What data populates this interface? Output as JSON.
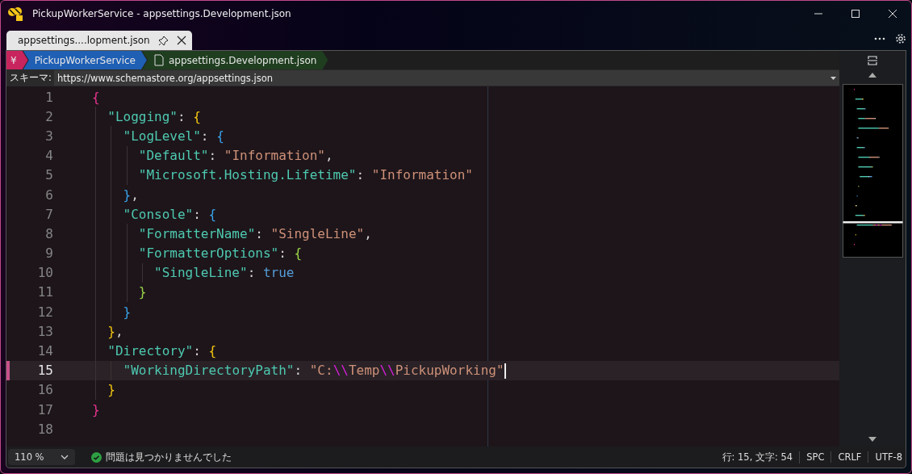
{
  "window": {
    "title": "PickupWorkerService - appsettings.Development.json"
  },
  "tabs": [
    {
      "label": "appsettings....lopment.json",
      "selected": true
    }
  ],
  "breadcrumb": [
    {
      "label": "¥",
      "kind": "root"
    },
    {
      "label": "PickupWorkerService",
      "kind": "project"
    },
    {
      "label": "appsettings.Development.json",
      "kind": "file"
    }
  ],
  "schema": {
    "label": "スキーマ:",
    "value": "https://www.schemastore.org/appsettings.json"
  },
  "editor": {
    "lines": [
      {
        "number": "1",
        "selected": false,
        "tokens": [
          {
            "kind": "open1",
            "text": "{"
          }
        ]
      },
      {
        "number": "2",
        "selected": false,
        "tokens": [
          {
            "kind": "key",
            "text": "\"Logging\""
          },
          {
            "kind": "punct",
            "text": ":"
          },
          {
            "kind": "open2",
            "text": "{"
          }
        ]
      },
      {
        "number": "3",
        "selected": false,
        "tokens": [
          {
            "kind": "key",
            "text": "\"LogLevel\""
          },
          {
            "kind": "punct",
            "text": ":"
          },
          {
            "kind": "open3",
            "text": "{"
          }
        ]
      },
      {
        "number": "4",
        "selected": false,
        "tokens": [
          {
            "kind": "key",
            "text": "\"Default\""
          },
          {
            "kind": "punct",
            "text": ":"
          },
          {
            "kind": "string",
            "text": "\"Information\""
          },
          {
            "kind": "punct",
            "text": ","
          }
        ]
      },
      {
        "number": "5",
        "selected": false,
        "tokens": [
          {
            "kind": "key",
            "text": "\"Microsoft.Hosting.Lifetime\""
          },
          {
            "kind": "punct",
            "text": ":"
          },
          {
            "kind": "string",
            "text": "\"Information\""
          }
        ]
      },
      {
        "number": "6",
        "selected": false,
        "tokens": [
          {
            "kind": "close3",
            "text": "}"
          },
          {
            "kind": "punct",
            "text": ","
          }
        ]
      },
      {
        "number": "7",
        "selected": false,
        "tokens": [
          {
            "kind": "key",
            "text": "\"Console\""
          },
          {
            "kind": "punct",
            "text": ":"
          },
          {
            "kind": "open3",
            "text": "{"
          }
        ]
      },
      {
        "number": "8",
        "selected": false,
        "tokens": [
          {
            "kind": "key",
            "text": "\"FormatterName\""
          },
          {
            "kind": "punct",
            "text": ":"
          },
          {
            "kind": "string",
            "text": "\"SingleLine\""
          },
          {
            "kind": "punct",
            "text": ","
          }
        ]
      },
      {
        "number": "9",
        "selected": false,
        "tokens": [
          {
            "kind": "key",
            "text": "\"FormatterOptions\""
          },
          {
            "kind": "punct",
            "text": ":"
          },
          {
            "kind": "open4",
            "text": "{"
          }
        ]
      },
      {
        "number": "10",
        "selected": false,
        "tokens": [
          {
            "kind": "key",
            "text": "\"SingleLine\""
          },
          {
            "kind": "punct",
            "text": ":"
          },
          {
            "kind": "keyword",
            "text": "true"
          }
        ]
      },
      {
        "number": "11",
        "selected": false,
        "tokens": [
          {
            "kind": "close4",
            "text": "}"
          }
        ]
      },
      {
        "number": "12",
        "selected": false,
        "tokens": [
          {
            "kind": "close3",
            "text": "}"
          }
        ]
      },
      {
        "number": "13",
        "selected": false,
        "tokens": [
          {
            "kind": "close2",
            "text": "}"
          },
          {
            "kind": "punct",
            "text": ","
          }
        ]
      },
      {
        "number": "14",
        "selected": false,
        "tokens": [
          {
            "kind": "key",
            "text": "\"Directory\""
          },
          {
            "kind": "punct",
            "text": ":"
          },
          {
            "kind": "open2",
            "text": "{"
          }
        ]
      },
      {
        "number": "15",
        "selected": true,
        "tokens": [
          {
            "kind": "key",
            "text": "\"WorkingDirectoryPath\""
          },
          {
            "kind": "punct",
            "text": ":"
          },
          {
            "kind": "string",
            "text": "\"C:"
          },
          {
            "kind": "escape",
            "text": "\\\\"
          },
          {
            "kind": "string",
            "text": "Temp"
          },
          {
            "kind": "escape",
            "text": "\\\\"
          },
          {
            "kind": "string",
            "text": "PickupWorking\""
          }
        ]
      },
      {
        "number": "16",
        "selected": false,
        "tokens": [
          {
            "kind": "close2",
            "text": "}"
          }
        ]
      },
      {
        "number": "17",
        "selected": false,
        "tokens": [
          {
            "kind": "close1",
            "text": "}"
          }
        ]
      },
      {
        "number": "18",
        "selected": false
      }
    ]
  },
  "status_bar": {
    "zoom": "110 %",
    "problems": "問題は見つかりませんでした",
    "position": "行: 15, 文字: 54",
    "indent": "SPC",
    "line_ending": "CRLF",
    "encoding": "UTF-8"
  }
}
